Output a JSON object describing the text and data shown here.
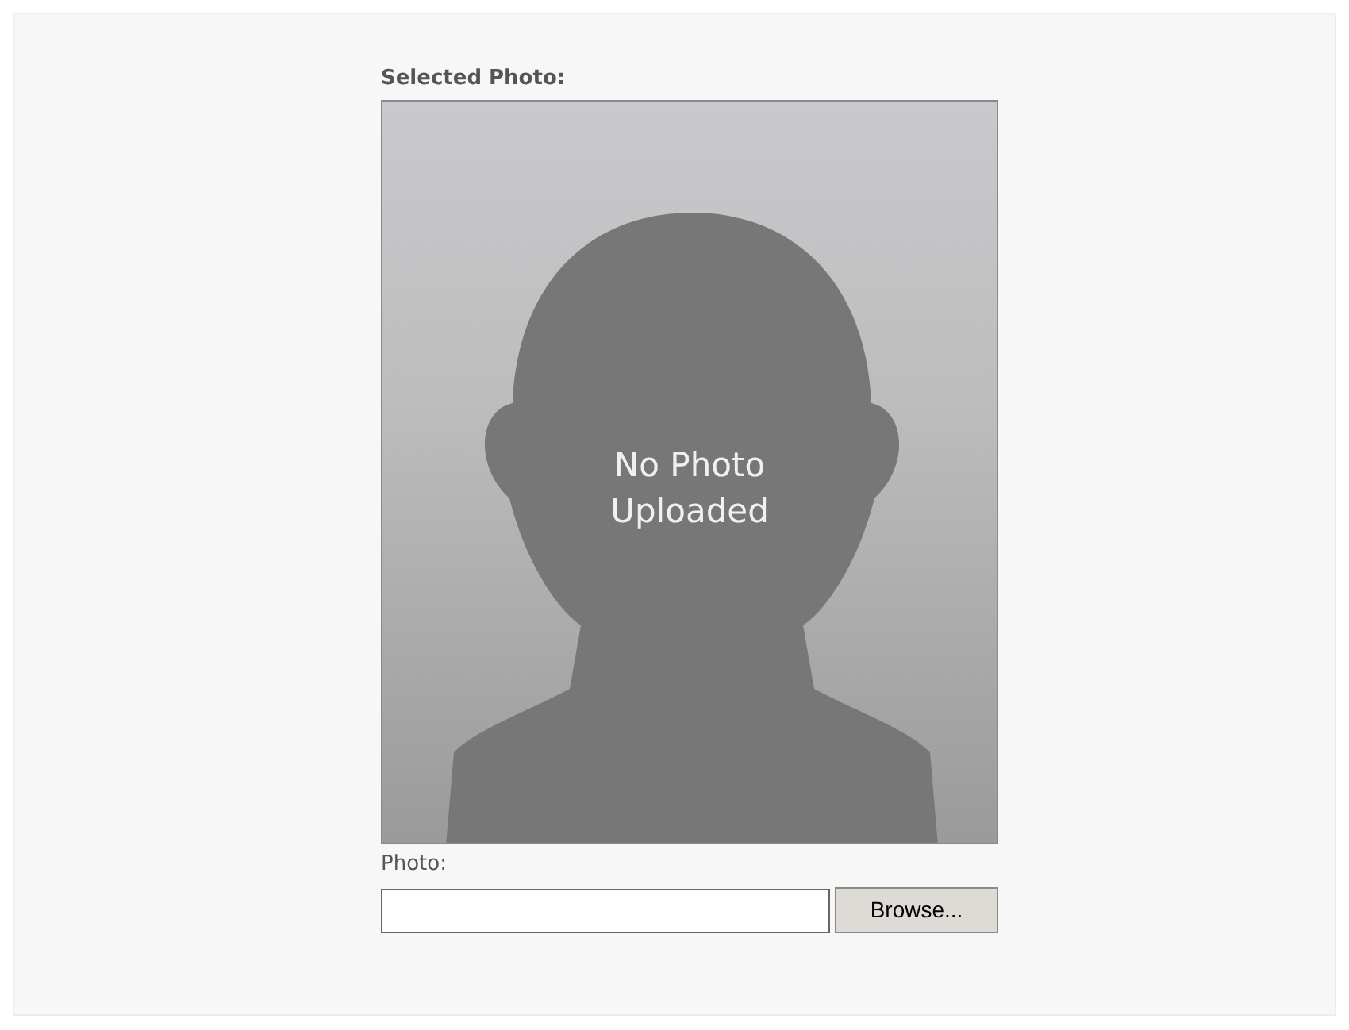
{
  "selected_photo": {
    "label": "Selected Photo:",
    "placeholder_text": [
      "No Photo",
      "Uploaded"
    ]
  },
  "photo_field": {
    "label": "Photo:",
    "button": "Browse..."
  }
}
